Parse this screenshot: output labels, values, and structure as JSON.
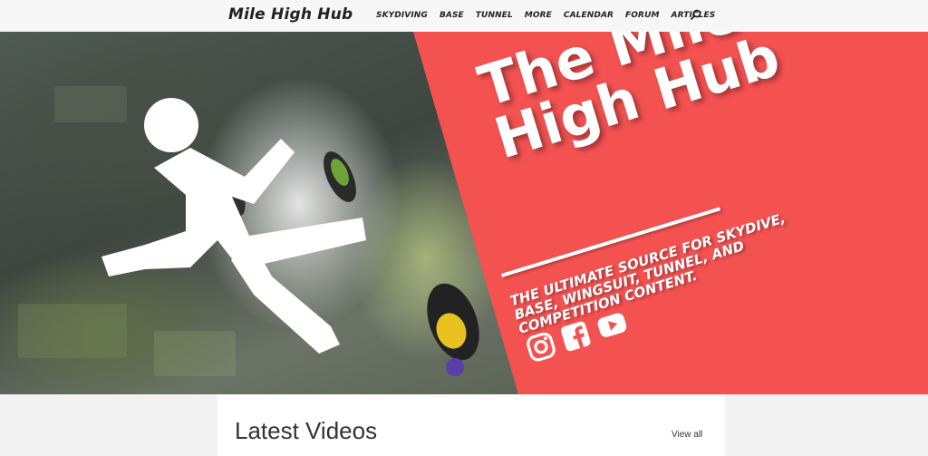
{
  "header": {
    "logo": "Mile High Hub",
    "nav": [
      "SKYDIVING",
      "BASE",
      "TUNNEL",
      "MORE",
      "CALENDAR",
      "FORUM",
      "ARTICLES"
    ]
  },
  "hero": {
    "title_line1": "The Mile",
    "title_line2": "High Hub",
    "subtitle": "THE ULTIMATE SOURCE FOR SKYDIVE, BASE, WINGSUIT, TUNNEL, AND COMPETITION CONTENT.",
    "social_icons": [
      "instagram-icon",
      "facebook-icon",
      "youtube-icon"
    ],
    "accent_color": "#f45151"
  },
  "latest": {
    "title": "Latest Videos",
    "view_all": "View all"
  }
}
